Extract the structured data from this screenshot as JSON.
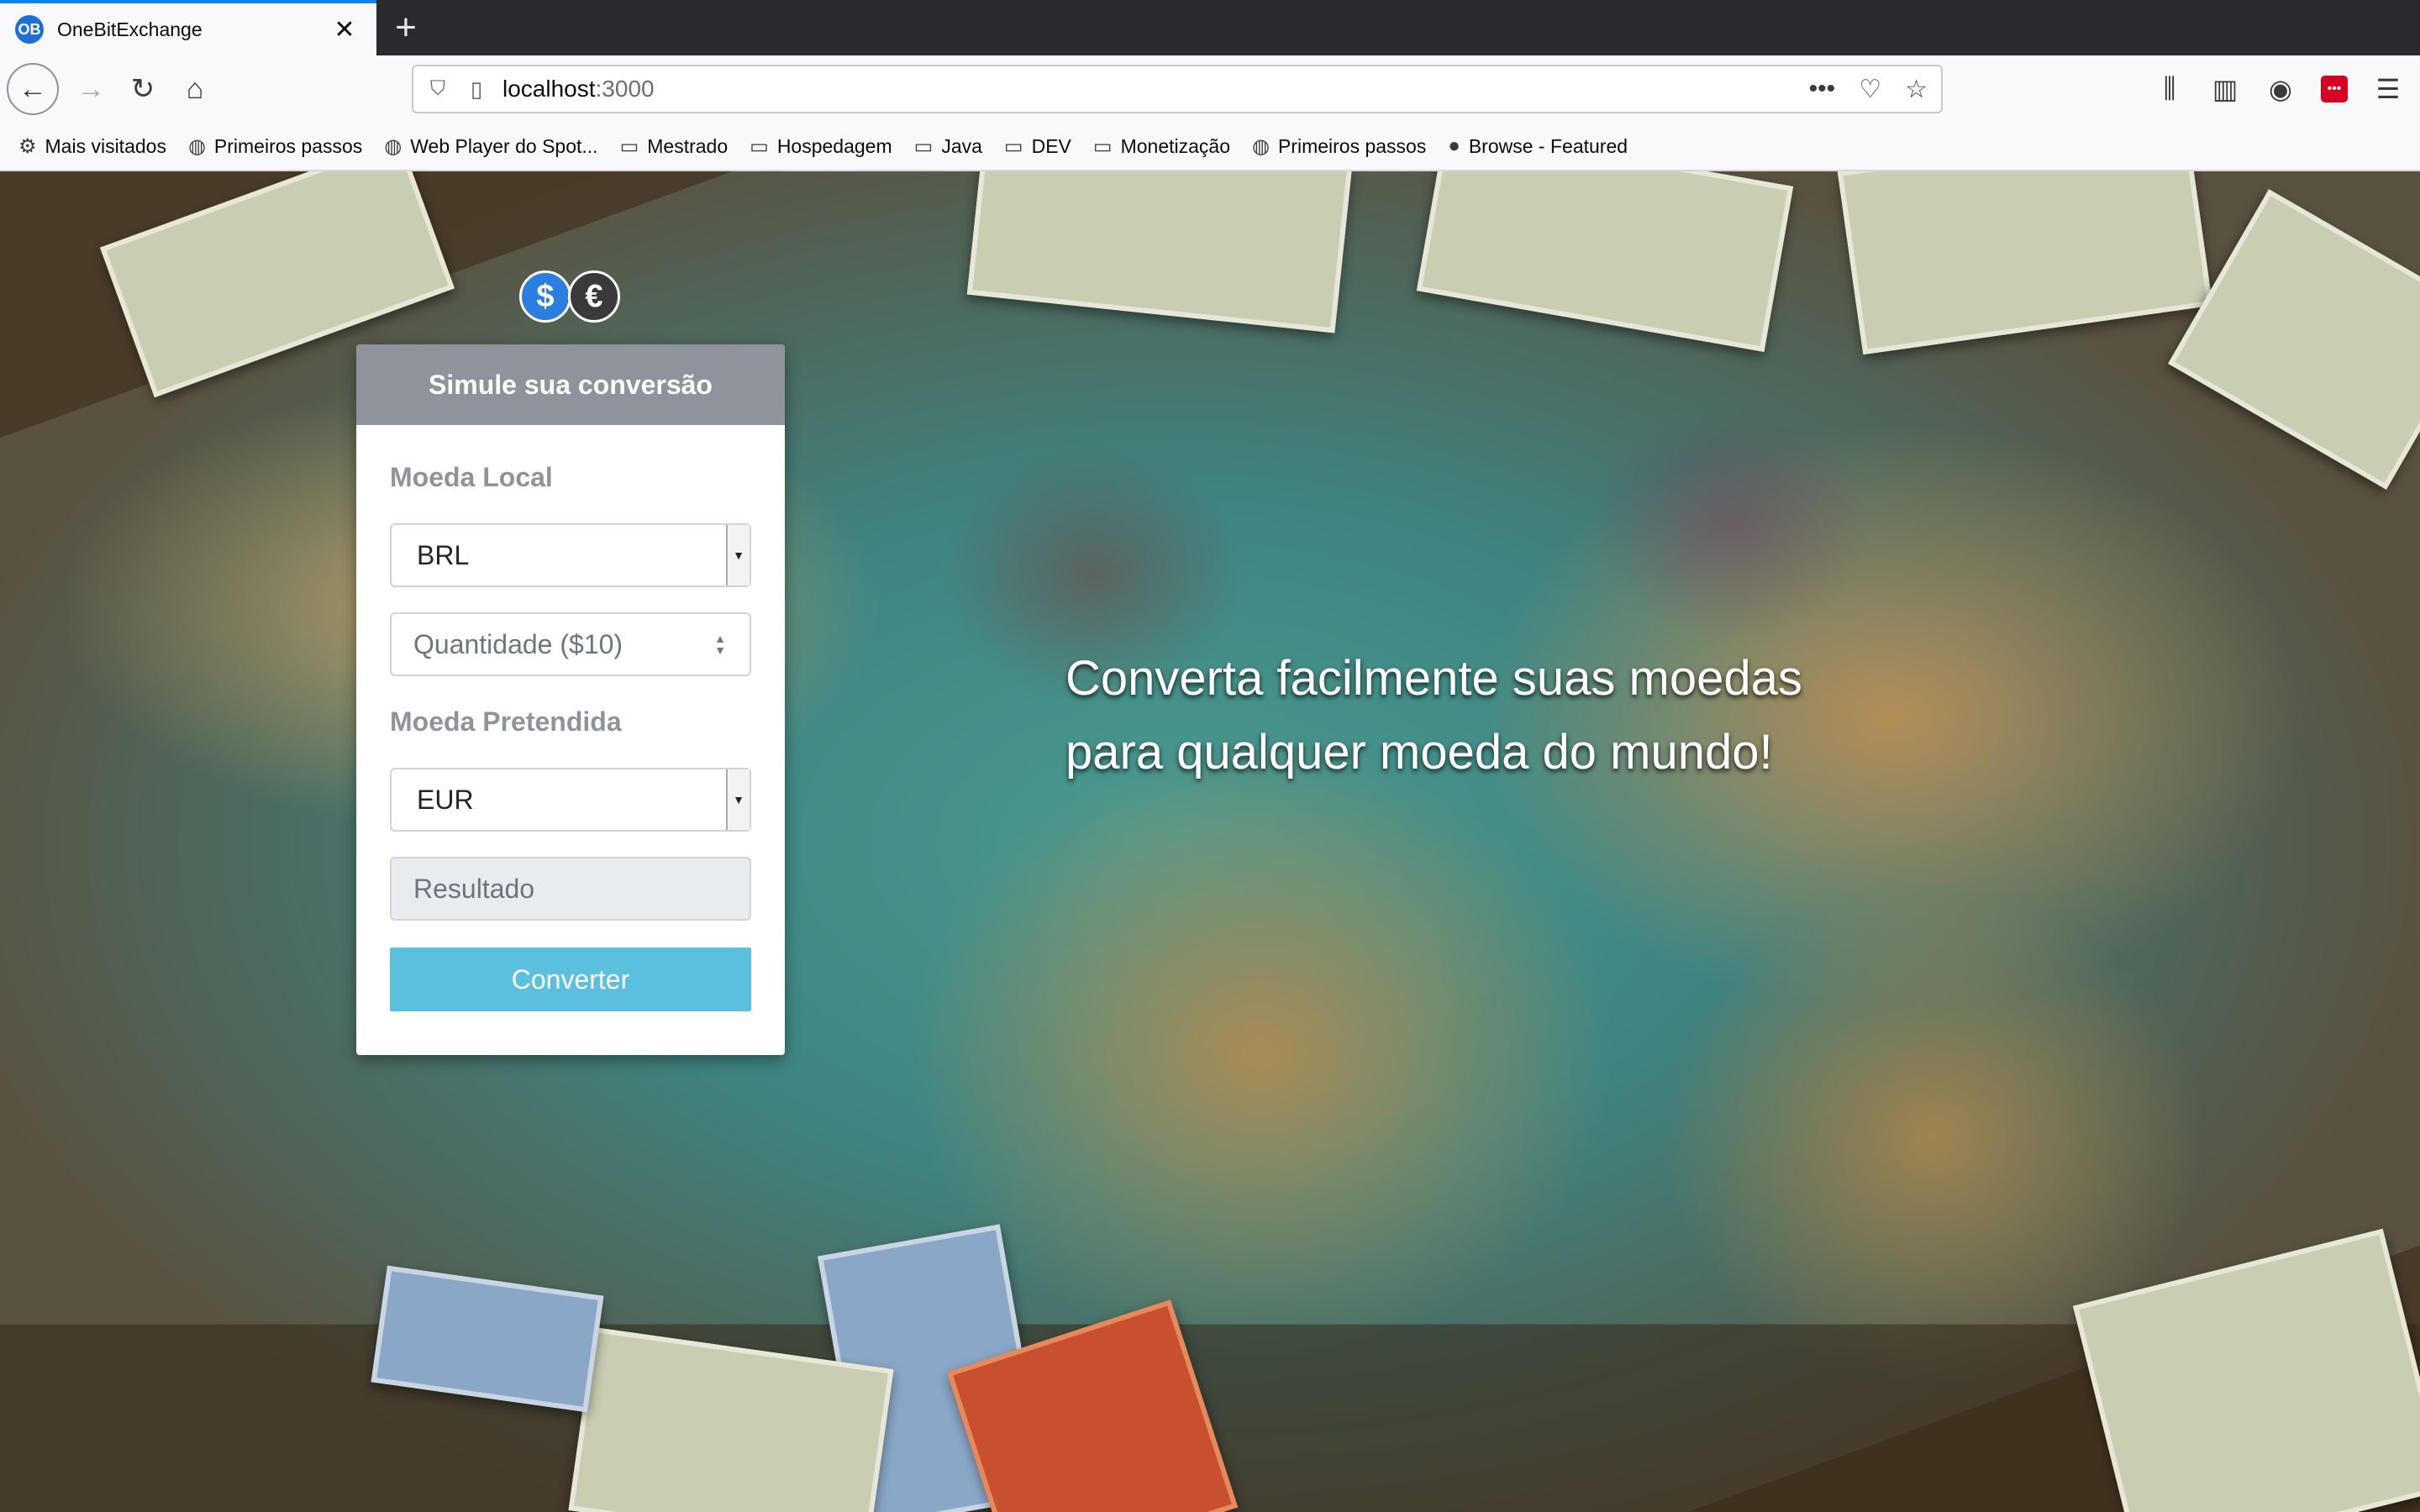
{
  "browser": {
    "tab_title": "OneBitExchange",
    "tab_favicon": "OB",
    "url_host": "localhost",
    "url_port": ":3000",
    "bookmarks": [
      {
        "label": "Mais visitados",
        "icon": "gear-icon"
      },
      {
        "label": "Primeiros passos",
        "icon": "globe-icon"
      },
      {
        "label": "Web Player do Spot...",
        "icon": "globe-icon"
      },
      {
        "label": "Mestrado",
        "icon": "folder-icon"
      },
      {
        "label": "Hospedagem",
        "icon": "folder-icon"
      },
      {
        "label": "Java",
        "icon": "folder-icon"
      },
      {
        "label": "DEV",
        "icon": "folder-icon"
      },
      {
        "label": "Monetização",
        "icon": "folder-icon"
      },
      {
        "label": "Primeiros passos",
        "icon": "globe-icon"
      },
      {
        "label": "Browse - Featured",
        "icon": "spotify-icon"
      }
    ]
  },
  "logo": {
    "usd": "$",
    "eur": "€"
  },
  "card": {
    "title": "Simule sua conversão",
    "local_label": "Moeda Local",
    "local_value": "BRL",
    "amount_placeholder": "Quantidade ($10)",
    "target_label": "Moeda Pretendida",
    "target_value": "EUR",
    "result_placeholder": "Resultado",
    "convert_label": "Converter"
  },
  "hero": {
    "line1": "Converta facilmente suas moedas",
    "line2": "para qualquer moeda do mundo!"
  },
  "colors": {
    "header_bg": "#8e939c",
    "button_bg": "#5bc0de",
    "tab_accent": "#0a84ff"
  }
}
